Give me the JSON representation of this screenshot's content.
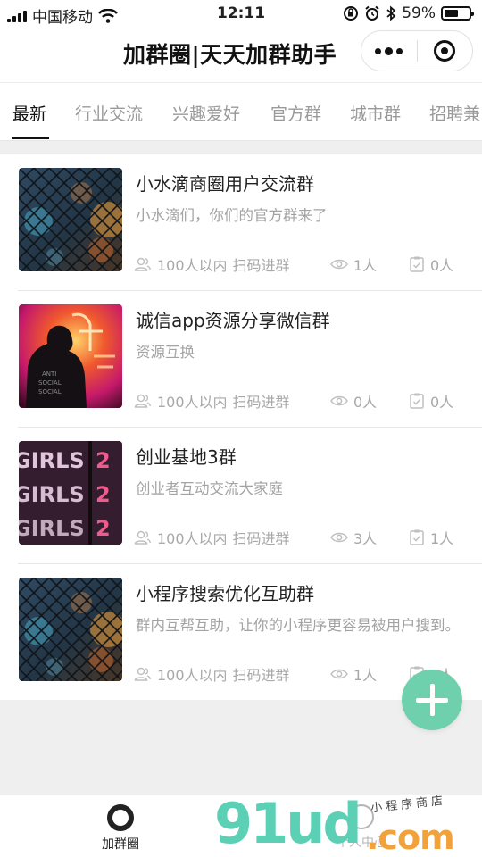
{
  "status_bar": {
    "carrier": "中国移动",
    "time": "12:11",
    "battery": "59%",
    "battery_level": 0.59,
    "icons": [
      "signal-icon",
      "wifi-icon",
      "rotation-lock-icon",
      "alarm-icon",
      "bluetooth-icon",
      "battery-icon"
    ]
  },
  "header": {
    "title": "加群圈|天天加群助手",
    "menu_icon": "more-dots-icon",
    "close_icon": "close-circle-icon"
  },
  "tabs": [
    {
      "label": "最新",
      "active": true
    },
    {
      "label": "行业交流",
      "active": false
    },
    {
      "label": "兴趣爱好",
      "active": false
    },
    {
      "label": "官方群",
      "active": false
    },
    {
      "label": "城市群",
      "active": false
    },
    {
      "label": "招聘兼",
      "active": false
    }
  ],
  "groups": [
    {
      "title": "小水滴商圈用户交流群",
      "desc": "小水滴们，你们的官方群来了",
      "size": "100人以内",
      "join": "扫码进群",
      "views": "1人",
      "joined": "0人",
      "thumb": "fence-bokeh"
    },
    {
      "title": "诚信app资源分享微信群",
      "desc": "资源互换",
      "size": "100人以内",
      "join": "扫码进群",
      "views": "0人",
      "joined": "0人",
      "thumb": "neon-hoodie"
    },
    {
      "title": "创业基地3群",
      "desc": "创业者互动交流大家庭",
      "size": "100人以内",
      "join": "扫码进群",
      "views": "3人",
      "joined": "1人",
      "thumb": "neon-girls"
    },
    {
      "title": "小程序搜索优化互助群",
      "desc": "群内互帮互助，让你的小程序更容易被用户搜到。",
      "size": "100人以内",
      "join": "扫码进群",
      "views": "1人",
      "joined": "0人",
      "thumb": "fence-bokeh"
    }
  ],
  "fab": {
    "icon": "plus-icon"
  },
  "bottom_nav": [
    {
      "label": "加群圈",
      "icon": "home-circle-icon",
      "active": true
    },
    {
      "label": "个人中心",
      "icon": "user-icon",
      "active": false
    }
  ],
  "watermark": {
    "logo": "91ud",
    "suffix": ".com",
    "sub": "小程序商店"
  },
  "colors": {
    "accent": "#6fd0ad",
    "text": "#222222",
    "muted": "#a3a3a3",
    "watermark_green": "#5bd0b4",
    "watermark_orange": "#f2a23b"
  }
}
